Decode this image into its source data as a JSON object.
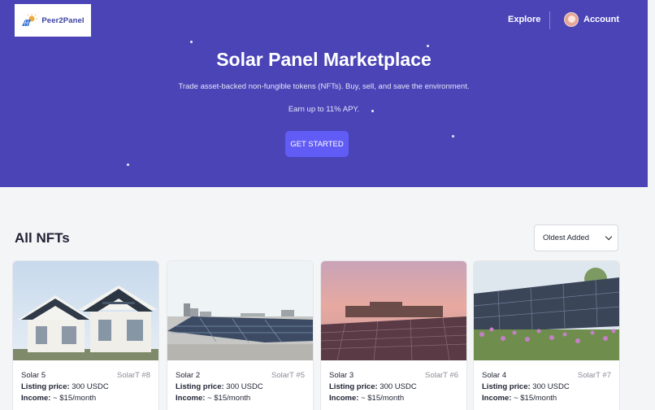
{
  "header": {
    "logo_text": "Peer2Panel",
    "nav_explore": "Explore",
    "nav_account": "Account"
  },
  "hero": {
    "title": "Solar Panel Marketplace",
    "subtitle": "Trade asset-backed non-fungible tokens (NFTs). Buy, sell, and save the environment.",
    "apy": "Earn up to 11% APY.",
    "cta": "GET STARTED"
  },
  "section": {
    "title": "All NFTs",
    "sort_selected": "Oldest Added"
  },
  "cards": [
    {
      "name": "Solar 5",
      "token": "SolarT #8",
      "price_label": "Listing price:",
      "price": "300 USDC",
      "income_label": "Income:",
      "income": "~ $15/month",
      "image": "houses-with-solar-roofs"
    },
    {
      "name": "Solar 2",
      "token": "SolarT #5",
      "price_label": "Listing price:",
      "price": "300 USDC",
      "income_label": "Income:",
      "income": "~ $15/month",
      "image": "rooftop-solar-array-city"
    },
    {
      "name": "Solar 3",
      "token": "SolarT #6",
      "price_label": "Listing price:",
      "price": "300 USDC",
      "income_label": "Income:",
      "income": "~ $15/month",
      "image": "solar-field-sunset"
    },
    {
      "name": "Solar 4",
      "token": "SolarT #7",
      "price_label": "Listing price:",
      "price": "300 USDC",
      "income_label": "Income:",
      "income": "~ $15/month",
      "image": "solar-panels-flowers"
    }
  ],
  "colors": {
    "hero_bg": "#4a44b7",
    "cta_bg": "#615cf5",
    "page_bg": "#f4f5f7"
  }
}
